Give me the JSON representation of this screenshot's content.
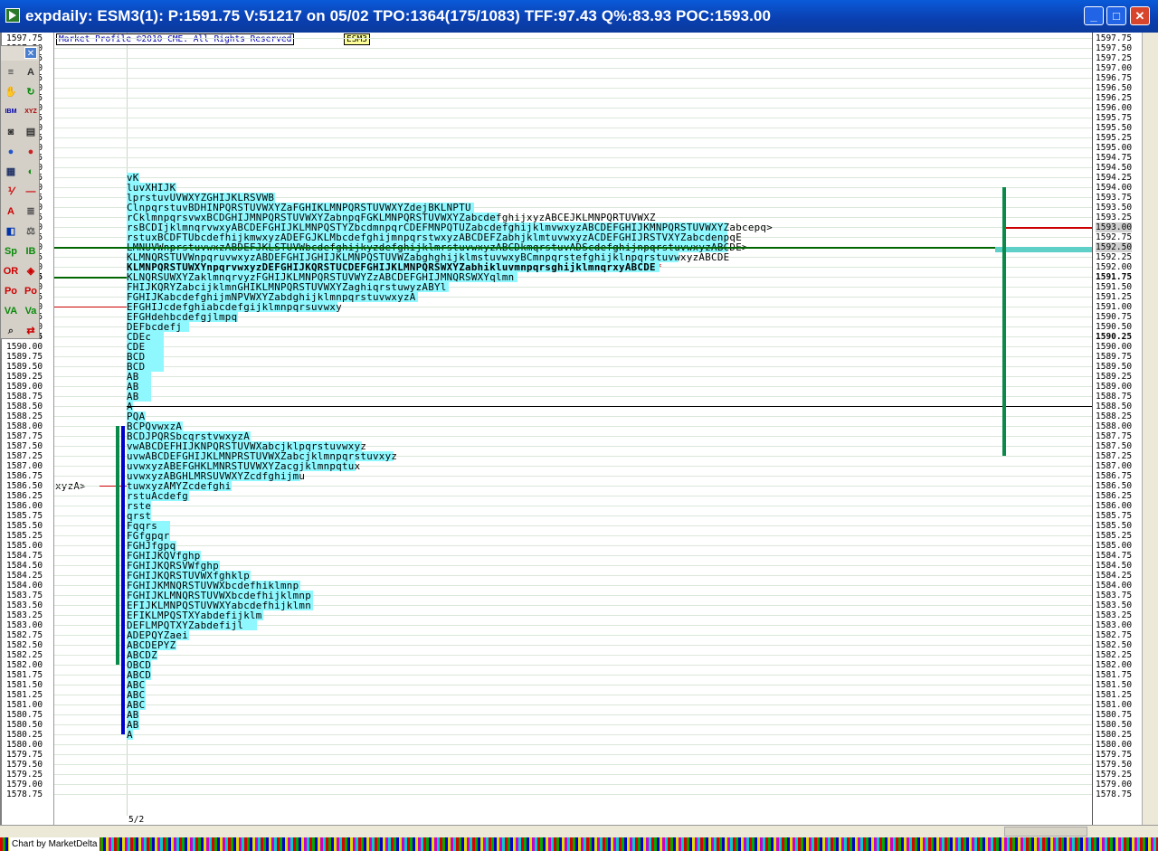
{
  "window": {
    "title": "expdaily: ESM3(1): P:1591.75 V:51217 on 05/02 TPO:1364(175/1083)  TFF:97.43 Q%:83.93 POC:1593.00",
    "minimize_label": "_",
    "maximize_label": "□",
    "close_label": "✕"
  },
  "chart": {
    "copyright": "Market Profile ©2010 CME. All Rights Reserved",
    "symbol": "ESM3",
    "date_label": "5/2",
    "credit": "Chart by MarketDelta",
    "last_price": "1591.75",
    "value_marker": "1590.25",
    "poc_price": "1593.00",
    "left_edge_text": "xyzA>",
    "price_ticks": [
      "1597.75",
      "1597.50",
      "1597.25",
      "1597.00",
      "1596.75",
      "1596.50",
      "1596.25",
      "1596.00",
      "1595.75",
      "1595.50",
      "1595.25",
      "1595.00",
      "1594.75",
      "1594.50",
      "1594.25",
      "1594.00",
      "1593.75",
      "1593.50",
      "1593.25",
      "1593.00",
      "1592.75",
      "1592.50",
      "1592.25",
      "1592.00",
      "1591.75",
      "1591.50",
      "1591.25",
      "1591.00",
      "1590.75",
      "1590.50",
      "1590.25",
      "1590.00",
      "1589.75",
      "1589.50",
      "1589.25",
      "1589.00",
      "1588.75",
      "1588.50",
      "1588.25",
      "1588.00",
      "1587.75",
      "1587.50",
      "1587.25",
      "1587.00",
      "1586.75",
      "1586.50",
      "1586.25",
      "1586.00",
      "1585.75",
      "1585.50",
      "1585.25",
      "1585.00",
      "1584.75",
      "1584.50",
      "1584.25",
      "1584.00",
      "1583.75",
      "1583.50",
      "1583.25",
      "1583.00",
      "1582.75",
      "1582.50",
      "1582.25",
      "1582.00",
      "1581.75",
      "1581.50",
      "1581.25",
      "1581.00",
      "1580.75",
      "1580.50",
      "1580.25",
      "1580.00",
      "1579.75",
      "1579.50",
      "1579.25",
      "1579.00",
      "1578.75"
    ],
    "profile_rows": [
      {
        "price": "1594.25",
        "text": "vK",
        "bar": 2
      },
      {
        "price": "1594.00",
        "text": "luvXHIJK",
        "bar": 8
      },
      {
        "price": "1593.75",
        "text": "lprstuvUVWXYZGHIJKLRSVWB",
        "bar": 24
      },
      {
        "price": "1593.50",
        "text": "ClnpqrstuvBDHINPQRSTUVWXYZaFGHIKLMNPQRSTUVWXYZdejBKLNPTU",
        "bar": 56
      },
      {
        "price": "1593.25",
        "text": "rCklmnpqrsvwxBCDGHIJMNPQRSTUVWXYZabnpqFGKLMNPQRSTUVWXYZabcdefghijxyzABCEJKLMNPQRTUVWXZ",
        "bar": 60
      },
      {
        "price": "1593.00",
        "text": "rsBCDIjklmnqrvwxyABCDEFGHIJKLMNPQSTYZbcdmnpqrCDEFMNPQTUZabcdefghijklmvwxyzABCDEFGHIJKMNPQRSTUVWXYZabcepq>",
        "bar": 97
      },
      {
        "price": "1592.75",
        "text": "rstuxBCDFTUbcdefhijkmwxyzADEFGJKLMbcdefghijmnpqrstwxyzABCDEFZabhjklmtuvwxyzACDEFGHIJRSTVXYZabcdenpqE",
        "bar": 97
      },
      {
        "price": "1592.50",
        "text": "LMNUVWnprstuvwxzABDEFJKLSTUVWbcdefghijkyzdefghijklmrstuvwxyzABCDkmqrstuvADScdefghijnpqrstuvwxyzABCDE>",
        "bar": 97
      },
      {
        "price": "1592.25",
        "text": "KLMNQRSTUVWnpqruvwxyzABDEFGHIJGHIJKLMNPQSTUVWZabghghijklmstuvwxyBCmnpqrstefghijklnpqrstuvwxyzABCDE",
        "bar": 89
      },
      {
        "price": "1592.00",
        "text": "KLMNPQRSTUWXYnpqrvwxyzDEFGHIJKQRSTUCDEFGHIJKLMNPQRSWXYZabhikluvmnpqrsghijklmnqrxyABCDE",
        "bar": 86,
        "bold": true,
        "star": true
      },
      {
        "price": "1591.75",
        "text": "KLNQRSUWXYZaklmnqrvyzFGHIJKLMNPQRSTUVWYZzABCDEFGHIJMNQRSWXYqlmn",
        "bar": 63
      },
      {
        "price": "1591.50",
        "text": "FHIJKQRYZabcijklmnGHIKLMNPQRSTUVWXYZaghiqrstuwyzABYl",
        "bar": 52
      },
      {
        "price": "1591.25",
        "text": "FGHIJKabcdefghijmNPVWXYZabdghijklmnpqrstuvwxyzA",
        "bar": 47
      },
      {
        "price": "1591.00",
        "text": "EFGHIJcdefghiabcdefgijklmnpqrsuvwxy",
        "bar": 34
      },
      {
        "price": "1590.75",
        "text": "EFGHdehbcdefgjlmpq",
        "bar": 18
      },
      {
        "price": "1590.50",
        "text": "DEFbcdefj",
        "bar": 10
      },
      {
        "price": "1590.25",
        "text": "CDEc",
        "bar": 6
      },
      {
        "price": "1590.00",
        "text": "CDE",
        "bar": 6
      },
      {
        "price": "1589.75",
        "text": "BCD",
        "bar": 6
      },
      {
        "price": "1589.50",
        "text": "BCD",
        "bar": 6
      },
      {
        "price": "1589.25",
        "text": "AB",
        "bar": 4
      },
      {
        "price": "1589.00",
        "text": "AB",
        "bar": 4
      },
      {
        "price": "1588.75",
        "text": "AB",
        "bar": 4
      },
      {
        "price": "1588.50",
        "text": "A",
        "bar": 1
      },
      {
        "price": "1588.25",
        "text": "PQA",
        "bar": 3
      },
      {
        "price": "1588.00",
        "text": "BCPQvwxzA",
        "bar": 9
      },
      {
        "price": "1587.75",
        "text": "BCDJPQRSbcqrstvwxyzA",
        "bar": 20
      },
      {
        "price": "1587.50",
        "text": "vwABCDEFHIJKNPQRSTUVWXabcjklpqrstuvwxyz",
        "bar": 38
      },
      {
        "price": "1587.25",
        "text": "uvwABCDEFGHIJKLMNPRSTUVWXZabcjklmnpqrstuvxyz",
        "bar": 43
      },
      {
        "price": "1587.00",
        "text": "uvwxyzABEFGHKLMNRSTUVWXYZacgjklmnpqtux",
        "bar": 37
      },
      {
        "price": "1586.75",
        "text": "uvwxyzABGHLMRSUVWXYZcdfghijmu",
        "bar": 28
      },
      {
        "price": "1586.50",
        "text": "tuwxyzAMYZcdefghi",
        "bar": 17
      },
      {
        "price": "1586.25",
        "text": "rstuAcdefg",
        "bar": 10
      },
      {
        "price": "1586.00",
        "text": "rste",
        "bar": 4
      },
      {
        "price": "1585.75",
        "text": "qrst",
        "bar": 4
      },
      {
        "price": "1585.50",
        "text": "Fqqrs",
        "bar": 7
      },
      {
        "price": "1585.25",
        "text": "FGfgpqr",
        "bar": 7
      },
      {
        "price": "1585.00",
        "text": "FGHJfgpq",
        "bar": 8
      },
      {
        "price": "1584.75",
        "text": "FGHIJKQVfghp",
        "bar": 12
      },
      {
        "price": "1584.50",
        "text": "FGHIJKQRSVWfghp",
        "bar": 15
      },
      {
        "price": "1584.25",
        "text": "FGHIJKQRSTUVWXfghklp",
        "bar": 20
      },
      {
        "price": "1584.00",
        "text": "FGHIJKMNQRSTUVWXbcdefhiklmnp",
        "bar": 28
      },
      {
        "price": "1583.75",
        "text": "FGHIJKLMNQRSTUVWXbcdefhijklmnp",
        "bar": 30
      },
      {
        "price": "1583.50",
        "text": "EFIJKLMNPQSTUVWXYabcdefhijklmn",
        "bar": 30
      },
      {
        "price": "1583.25",
        "text": "EFIKLMPQSTXYabdefijklm",
        "bar": 22
      },
      {
        "price": "1583.00",
        "text": "DEFLMPQTXYZabdefijl",
        "bar": 21
      },
      {
        "price": "1582.75",
        "text": "ADEPQYZaei",
        "bar": 10
      },
      {
        "price": "1582.50",
        "text": "ABCDEPYZ",
        "bar": 8
      },
      {
        "price": "1582.25",
        "text": "ABCDZ",
        "bar": 5
      },
      {
        "price": "1582.00",
        "text": "OBCD",
        "bar": 4
      },
      {
        "price": "1581.75",
        "text": "ABCD",
        "bar": 4
      },
      {
        "price": "1581.50",
        "text": "ABC",
        "bar": 3
      },
      {
        "price": "1581.25",
        "text": "ABC",
        "bar": 3
      },
      {
        "price": "1581.00",
        "text": "ABC",
        "bar": 3
      },
      {
        "price": "1580.75",
        "text": "AB",
        "bar": 2
      },
      {
        "price": "1580.50",
        "text": "AB",
        "bar": 2
      },
      {
        "price": "1580.25",
        "text": "A",
        "bar": 1
      }
    ]
  },
  "toolbox": {
    "close_label": "✕",
    "tools": [
      {
        "name": "bars-tool",
        "glyph": "≡",
        "color": "#333333"
      },
      {
        "name": "letters-tool",
        "glyph": "A",
        "color": "#333333"
      },
      {
        "name": "hand-tool",
        "glyph": "✋",
        "color": "#333333"
      },
      {
        "name": "refresh-tool",
        "glyph": "↻",
        "color": "#0a8a0a"
      },
      {
        "name": "ibm-tool",
        "glyph": "IBM",
        "color": "#0000aa"
      },
      {
        "name": "xyz-tool",
        "glyph": "XYZ",
        "color": "#aa0000"
      },
      {
        "name": "camera-tool",
        "glyph": "◙",
        "color": "#333333"
      },
      {
        "name": "notes-tool",
        "glyph": "▤",
        "color": "#333333"
      },
      {
        "name": "color-wheel-tool",
        "glyph": "●",
        "color": "#2255cc"
      },
      {
        "name": "palette-tool",
        "glyph": "●",
        "color": "#cc2222"
      },
      {
        "name": "grid-tool",
        "glyph": "▦",
        "color": "#223366"
      },
      {
        "name": "half-circle-tool",
        "glyph": "◐",
        "color": "#0a8a0a"
      },
      {
        "name": "fraction-tool",
        "glyph": "⅟",
        "color": "#cc0000"
      },
      {
        "name": "line-tool",
        "glyph": "—",
        "color": "#cc0000"
      },
      {
        "name": "text-tool",
        "glyph": "A",
        "color": "#cc0000"
      },
      {
        "name": "align-tool",
        "glyph": "≣",
        "color": "#555555"
      },
      {
        "name": "split-tool",
        "glyph": "◧",
        "color": "#0033aa"
      },
      {
        "name": "scale-tool",
        "glyph": "⚖",
        "color": "#555555"
      },
      {
        "name": "sp-tool",
        "glyph": "Sp",
        "color": "#0a8a0a"
      },
      {
        "name": "ib-tool",
        "glyph": "IB",
        "color": "#0a8a0a"
      },
      {
        "name": "or-tool",
        "glyph": "OR",
        "color": "#cc0000"
      },
      {
        "name": "diamond-tool",
        "glyph": "◈",
        "color": "#cc0000"
      },
      {
        "name": "poc-tool",
        "glyph": "Po",
        "color": "#cc0000"
      },
      {
        "name": "pocv-tool",
        "glyph": "Po",
        "color": "#cc0000"
      },
      {
        "name": "va-tool",
        "glyph": "VA",
        "color": "#0a8a0a"
      },
      {
        "name": "vavo-tool",
        "glyph": "Va",
        "color": "#0a8a0a"
      },
      {
        "name": "zoom-tool",
        "glyph": "⌕",
        "color": "#333333"
      },
      {
        "name": "arrows-tool",
        "glyph": "⇄",
        "color": "#cc0000"
      }
    ]
  },
  "colors": {
    "tpo_fill": "#8ff8ff",
    "value_area_bar": "#0a8a4a",
    "ib_bar": "#0000cc",
    "poc_line": "#cc0000",
    "value_line": "#006600",
    "last_price_line": "#cc0000"
  }
}
